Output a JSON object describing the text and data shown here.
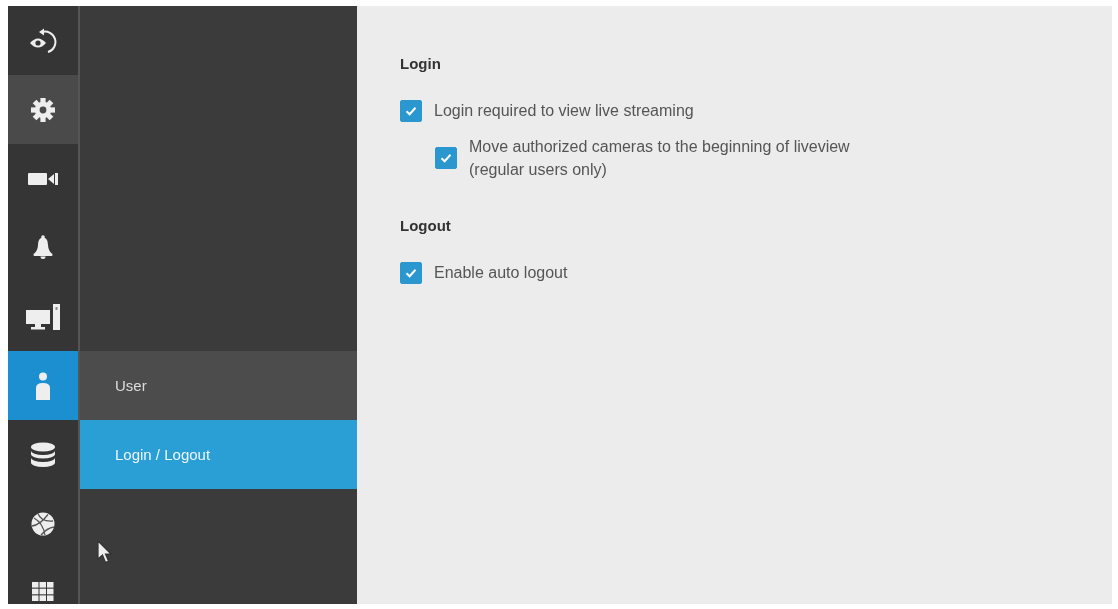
{
  "rail": [
    {
      "selected": false,
      "hovered": false
    },
    {
      "selected": false,
      "hovered": true
    },
    {
      "selected": false,
      "hovered": false
    },
    {
      "selected": false,
      "hovered": false
    },
    {
      "selected": false,
      "hovered": false
    },
    {
      "selected": true,
      "hovered": false
    },
    {
      "selected": false,
      "hovered": false
    },
    {
      "selected": false,
      "hovered": false
    },
    {
      "selected": false,
      "hovered": false
    }
  ],
  "submenu": {
    "items": [
      {
        "label": "User",
        "selected": false
      },
      {
        "label": "Login / Logout",
        "selected": true
      }
    ]
  },
  "content": {
    "sections": [
      {
        "title": "Login",
        "options": [
          {
            "label": "Login required to view live streaming",
            "checked": true,
            "children": [
              {
                "label": "Move authorized cameras to the beginning of liveview\n(regular users only)",
                "checked": true
              }
            ]
          }
        ]
      },
      {
        "title": "Logout",
        "options": [
          {
            "label": "Enable auto logout",
            "checked": true
          }
        ]
      }
    ]
  }
}
